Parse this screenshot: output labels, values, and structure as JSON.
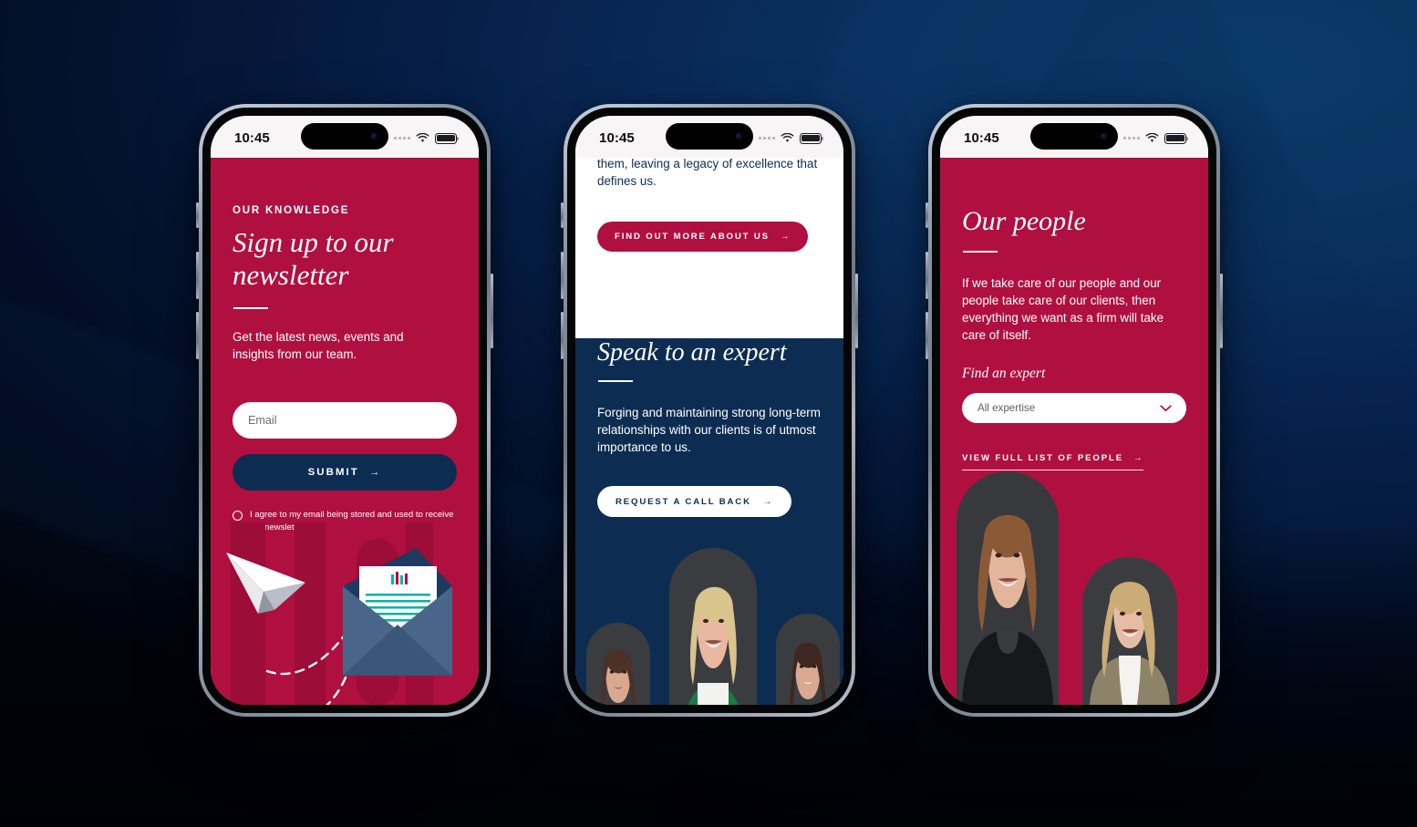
{
  "theme": {
    "crimson": "#b0103f",
    "navy": "#0d2c51",
    "bg_blue_light": "#0b3a68",
    "bg_blue_dark": "#01050e",
    "white": "#ffffff"
  },
  "status_bar": {
    "time": "10:45",
    "signal_icon": "cellular-signal-icon",
    "wifi_icon": "wifi-icon",
    "battery_icon": "battery-icon"
  },
  "phone1": {
    "name": "newsletter-signup-screen",
    "eyebrow": "OUR KNOWLEDGE",
    "heading": "Sign up to our newsletter",
    "body": "Get the latest news, events and insights from our team.",
    "email_placeholder": "Email",
    "email_value": "",
    "submit_label": "SUBMIT",
    "submit_arrow": "→",
    "consent_label": "I agree to my email being stored and used to receive the newsletter.",
    "consent_checked": false,
    "illustration": "paper-plane-and-open-envelope-illustration"
  },
  "phone2": {
    "name": "speak-to-an-expert-screen",
    "cut_paragraph": "them, leaving a legacy of excellence that defines us.",
    "find_out_more_label": "FIND OUT MORE ABOUT US",
    "find_out_more_arrow": "→",
    "heading": "Speak to an expert",
    "body": "Forging and maintaining strong long-term relationships with our clients is of utmost importance to us.",
    "callback_label": "REQUEST A CALL BACK",
    "callback_arrow": "→",
    "photos": [
      {
        "alt": "expert-portrait-left",
        "outfit": "#e7e2e0"
      },
      {
        "alt": "expert-portrait-centre",
        "outfit": "#1d7a46"
      },
      {
        "alt": "expert-portrait-right",
        "outfit": "#1939c4"
      }
    ]
  },
  "phone3": {
    "name": "our-people-screen",
    "heading": "Our people",
    "body": "If we take care of our people and our people take care of our clients, then everything we want as a firm will take care of itself.",
    "find_an_expert_label": "Find an expert",
    "select_value": "All expertise",
    "select_chevron": "chevron-down-icon",
    "view_list_label": "VIEW FULL LIST OF PEOPLE",
    "view_list_arrow": "→",
    "photos": [
      {
        "alt": "person-portrait-large",
        "outfit": "#17181c"
      },
      {
        "alt": "person-portrait-small",
        "outfit": "#8d8368"
      }
    ]
  }
}
